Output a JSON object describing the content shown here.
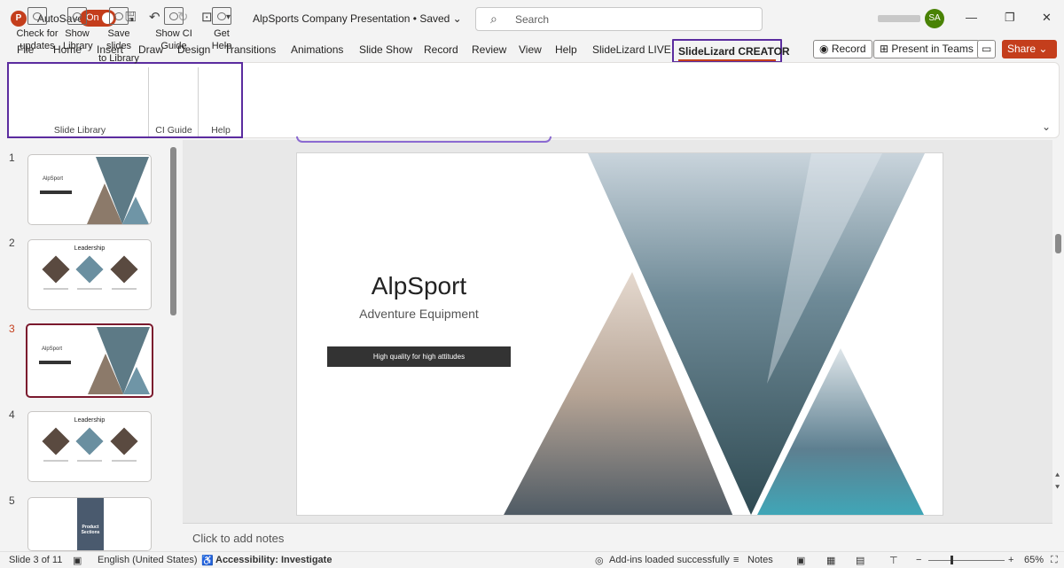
{
  "titlebar": {
    "autosave_label": "AutoSave",
    "autosave_state": "On",
    "file_title": "AlpSports Company Presentation",
    "saved_state": "• Saved",
    "search_placeholder": "Search",
    "user_initials": "SA"
  },
  "tabs": [
    "File",
    "Home",
    "Insert",
    "Draw",
    "Design",
    "Transitions",
    "Animations",
    "Slide Show",
    "Record",
    "Review",
    "View",
    "Help",
    "SlideLizard LIVE"
  ],
  "active_tab": "SlideLizard CREATOR",
  "top_buttons": {
    "record": "Record",
    "present": "Present in Teams",
    "share": "Share"
  },
  "ribbon": {
    "check_updates": "Check for\nupdates",
    "show_library": "Show\nLibrary",
    "save_slides": "Save slides\nto Library",
    "show_ci": "Show CI\nGuide",
    "get_help": "Get\nHelp",
    "group_slide_library": "Slide Library",
    "group_ci_guide": "CI Guide",
    "group_help": "Help"
  },
  "thumbnails": [
    {
      "num": "1",
      "title": "AlpSport"
    },
    {
      "num": "2",
      "title": "Leadership"
    },
    {
      "num": "3",
      "title": "AlpSport"
    },
    {
      "num": "4",
      "title": "Leadership"
    },
    {
      "num": "5",
      "title": "Product Sections"
    }
  ],
  "slide": {
    "title": "AlpSport",
    "subtitle": "Adventure Equipment",
    "tagline": "High quality for high attitudes"
  },
  "notes_placeholder": "Click to add notes",
  "status": {
    "slide_of": "Slide 3 of 11",
    "language": "English (United States)",
    "accessibility": "Accessibility: Investigate",
    "addins": "Add-ins loaded successfully",
    "notes": "Notes",
    "zoom": "65%"
  },
  "colors": {
    "accent": "#c43e1c",
    "highlight": "#5b2c9f",
    "selected_thumb": "#7b1a2e"
  }
}
